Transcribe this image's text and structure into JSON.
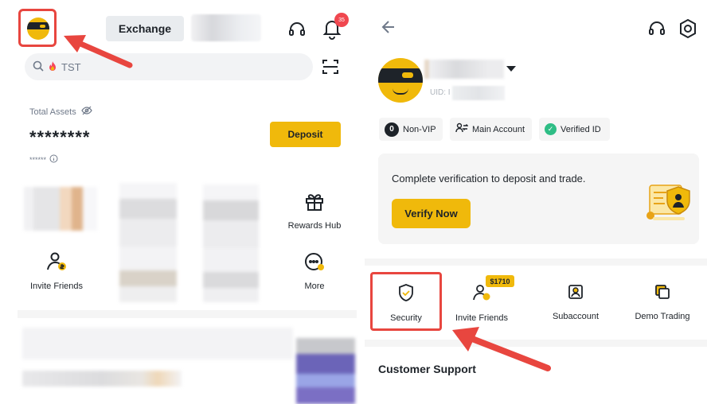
{
  "colors": {
    "accent": "#f0b90b",
    "highlight_red": "#e8463f",
    "verified_green": "#2ebd85",
    "notification_red": "#f0474f"
  },
  "left_panel": {
    "header": {
      "tab_exchange": "Exchange",
      "notification_count": "35"
    },
    "search": {
      "placeholder": "TST"
    },
    "assets": {
      "label": "Total Assets",
      "value": "********",
      "sub_value": "******",
      "deposit_label": "Deposit"
    },
    "shortcuts": {
      "rewards_label": "Rewards Hub",
      "invite_label": "Invite Friends",
      "more_label": "More"
    }
  },
  "right_panel": {
    "profile": {
      "uid_label": "UID: I"
    },
    "tags": {
      "vip_level": "0",
      "vip_label": "Non-VIP",
      "account_label": "Main Account",
      "verified_label": "Verified ID"
    },
    "verification_card": {
      "message": "Complete verification to deposit and trade.",
      "button_label": "Verify Now"
    },
    "quick_actions": {
      "security_label": "Security",
      "invite_label": "Invite Friends",
      "invite_bonus": "$1710",
      "subaccount_label": "Subaccount",
      "demo_label": "Demo Trading"
    },
    "support": {
      "title": "Customer Support"
    }
  }
}
